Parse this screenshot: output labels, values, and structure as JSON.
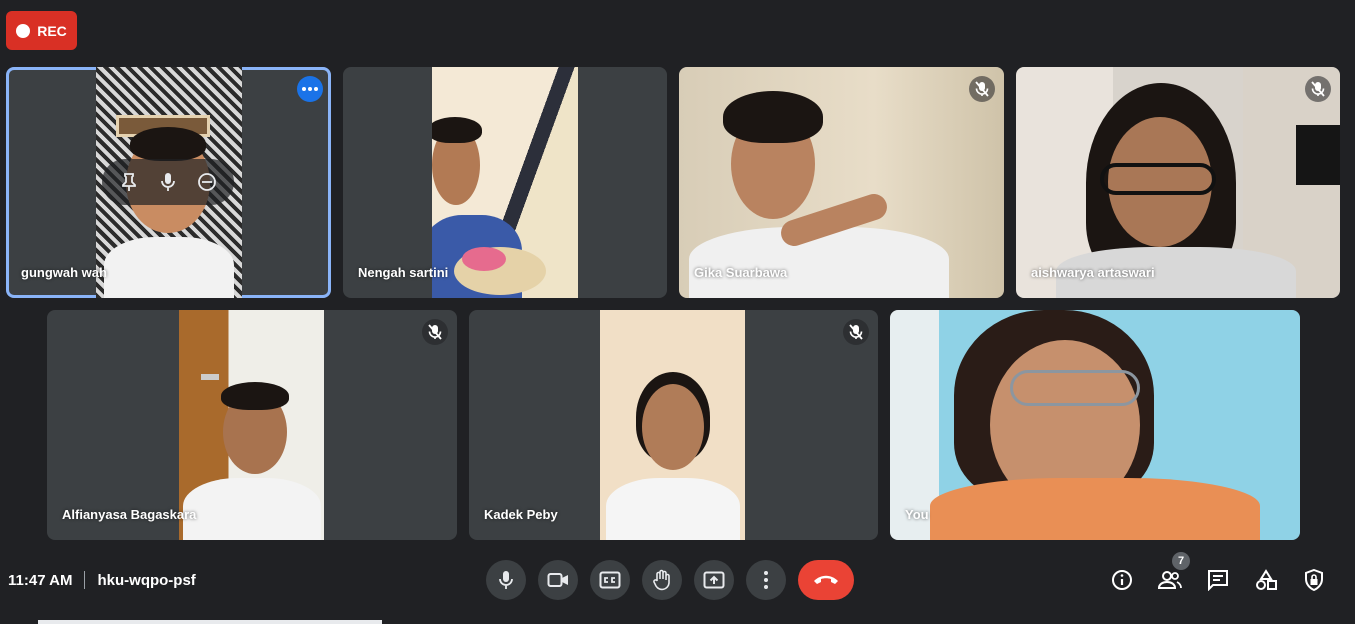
{
  "recording": {
    "label": "REC"
  },
  "participants": [
    {
      "name": "gungwah wah",
      "muted": false,
      "pinned_hover": true
    },
    {
      "name": "Nengah sartini",
      "muted": false
    },
    {
      "name": "Gika Suarbawa",
      "muted": true
    },
    {
      "name": "aishwarya artaswari",
      "muted": true
    },
    {
      "name": "Alfianyasa Bagaskara",
      "muted": true
    },
    {
      "name": "Kadek Peby",
      "muted": true
    },
    {
      "name": "You",
      "muted": false
    }
  ],
  "meeting": {
    "time": "11:47 AM",
    "code": "hku-wqpo-psf"
  },
  "people_count": "7",
  "colors": {
    "background": "#202124",
    "tile": "#3c4043",
    "accent": "#8ab4f8",
    "end_call": "#ea4335",
    "rec": "#d93025"
  },
  "controls": [
    "microphone-icon",
    "camera-icon",
    "captions-icon",
    "raise-hand-icon",
    "present-icon",
    "more-options-icon",
    "end-call-icon"
  ],
  "side_controls": [
    "info-icon",
    "people-icon",
    "chat-icon",
    "activities-icon",
    "host-controls-icon"
  ]
}
